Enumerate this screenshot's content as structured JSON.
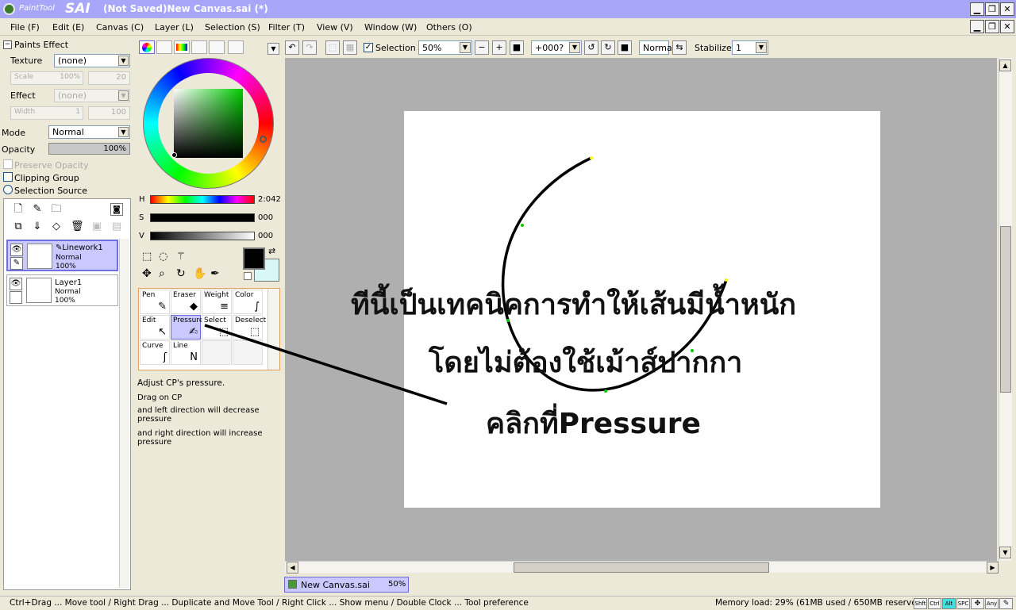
{
  "app": {
    "logo_text": "PaintTool",
    "logo_sai": "SAI",
    "window_title": "(Not Saved)New Canvas.sai (*)"
  },
  "menu": [
    "File (F)",
    "Edit (E)",
    "Canvas (C)",
    "Layer (L)",
    "Selection (S)",
    "Filter (T)",
    "View (V)",
    "Window (W)",
    "Others (O)"
  ],
  "paints_effect": {
    "header": "Paints Effect",
    "texture_label": "Texture",
    "texture_value": "(none)",
    "scale_label": "Scale",
    "scale_value": "100%",
    "scale_num": "20",
    "effect_label": "Effect",
    "effect_value": "(none)",
    "width_label": "Width",
    "width_value": "1",
    "width_num": "100"
  },
  "layer_props": {
    "mode_label": "Mode",
    "mode_value": "Normal",
    "opacity_label": "Opacity",
    "opacity_value": "100%",
    "preserve_opacity": "Preserve Opacity",
    "clipping_group": "Clipping Group",
    "selection_source": "Selection Source"
  },
  "layers": [
    {
      "name": "Linework1",
      "mode": "Normal",
      "opacity": "100%",
      "selected": true
    },
    {
      "name": "Layer1",
      "mode": "Normal",
      "opacity": "100%",
      "selected": false
    }
  ],
  "color": {
    "h_label": "H",
    "h_value": "2:042",
    "s_label": "S",
    "s_value": "000",
    "v_label": "V",
    "v_value": "000",
    "primary": "#000000",
    "secondary": "#d8f8f8"
  },
  "tools": [
    {
      "label": "Pen",
      "icon": "pen-icon"
    },
    {
      "label": "Eraser",
      "icon": "eraser-icon"
    },
    {
      "label": "Weight",
      "icon": "weight-icon"
    },
    {
      "label": "Color",
      "icon": "color-icon"
    },
    {
      "label": "Edit",
      "icon": "edit-cursor-icon"
    },
    {
      "label": "Pressure",
      "icon": "pressure-icon"
    },
    {
      "label": "Select",
      "icon": "select-icon"
    },
    {
      "label": "Deselect",
      "icon": "deselect-icon"
    },
    {
      "label": "Curve",
      "icon": "curve-icon"
    },
    {
      "label": "Line",
      "icon": "line-icon"
    }
  ],
  "tool_help": {
    "title": "Adjust CP's pressure.",
    "line1": "Drag on CP",
    "line2": "and left direction will decrease pressure",
    "line3": "and right direction will increase pressure"
  },
  "toolbar": {
    "selection_label": "Selection",
    "zoom": "50%",
    "rotation": "+000?",
    "blend_mode": "Normal",
    "stabilizer_label": "Stabilizer",
    "stabilizer_value": "1"
  },
  "annotation": {
    "line1": "ทีนี้เป็นเทคนิคการทำให้เส้นมีน้ำหนัก",
    "line2": "โดยไม่ต้องใช้เม้าส์ปากกา",
    "line3": "คลิกที่Pressure"
  },
  "document_tab": {
    "name": "New Canvas.sai",
    "zoom": "50%"
  },
  "status": {
    "hint": "Ctrl+Drag ... Move tool / Right Drag ... Duplicate and Move Tool / Right Click ... Show menu / Double Clock ... Tool preference",
    "memory": "Memory load: 29% (61MB used / 650MB reserved)",
    "keys": [
      "Shft",
      "Ctrl",
      "Alt",
      "SPC",
      "Any"
    ]
  }
}
